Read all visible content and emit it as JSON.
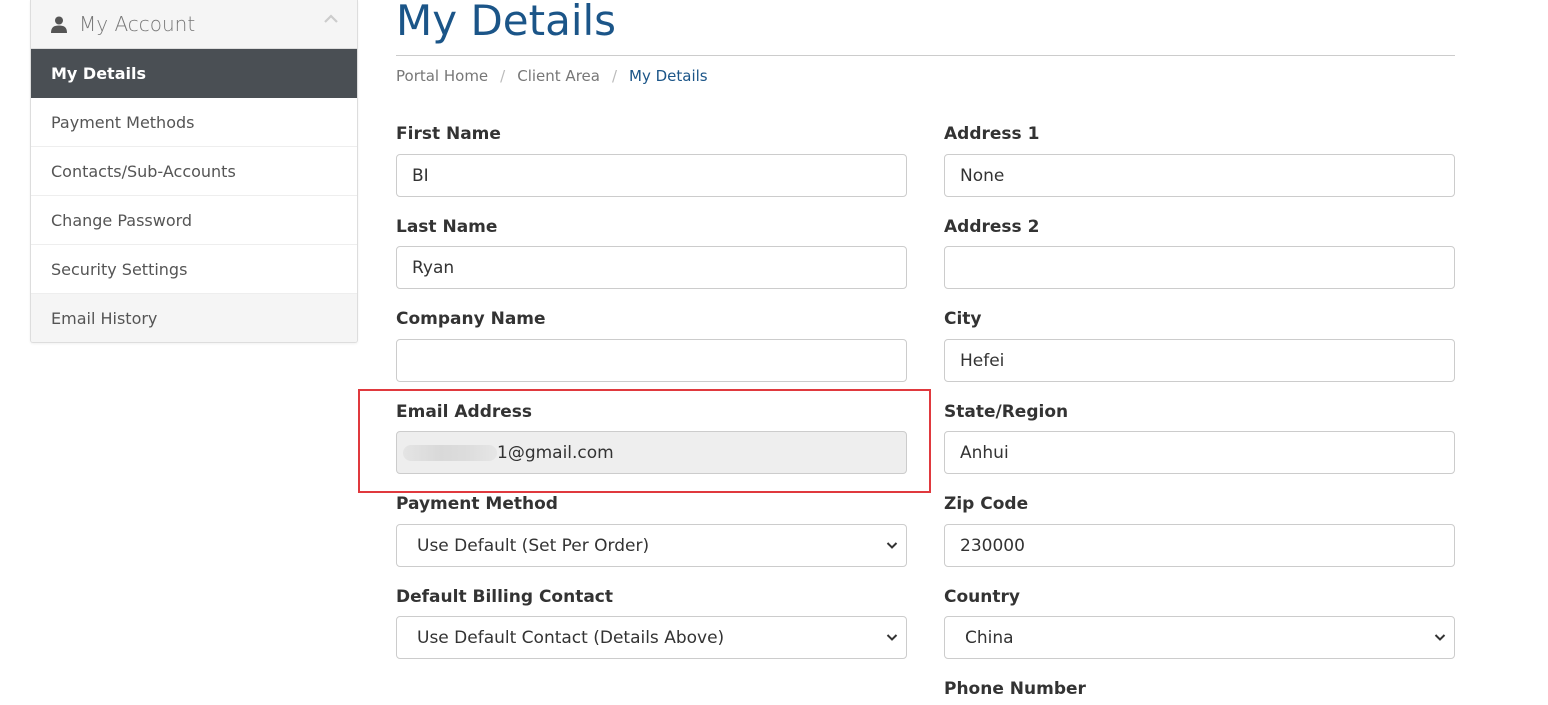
{
  "sidebar": {
    "header": {
      "title": "My Account",
      "icon": "user-icon",
      "toggle_icon": "chevron-up-icon"
    },
    "items": [
      {
        "label": "My Details",
        "active": true
      },
      {
        "label": "Payment Methods"
      },
      {
        "label": "Contacts/Sub-Accounts"
      },
      {
        "label": "Change Password"
      },
      {
        "label": "Security Settings"
      },
      {
        "label": "Email History"
      }
    ]
  },
  "page": {
    "title": "My Details",
    "breadcrumb": [
      "Portal Home",
      "Client Area",
      "My Details"
    ],
    "breadcrumb_separator": "/"
  },
  "form": {
    "first_name": {
      "label": "First Name",
      "value": "BI"
    },
    "last_name": {
      "label": "Last Name",
      "value": "Ryan"
    },
    "company_name": {
      "label": "Company Name",
      "value": ""
    },
    "email": {
      "label": "Email Address",
      "value_visible": "1@gmail.com",
      "redacted": true
    },
    "payment_method": {
      "label": "Payment Method",
      "selected": "Use Default (Set Per Order)"
    },
    "billing_contact": {
      "label": "Default Billing Contact",
      "selected": "Use Default Contact (Details Above)"
    },
    "address1": {
      "label": "Address 1",
      "value": "None"
    },
    "address2": {
      "label": "Address 2",
      "value": ""
    },
    "city": {
      "label": "City",
      "value": "Hefei"
    },
    "state": {
      "label": "State/Region",
      "value": "Anhui"
    },
    "zip": {
      "label": "Zip Code",
      "value": "230000"
    },
    "country": {
      "label": "Country",
      "selected": "China"
    },
    "phone": {
      "label": "Phone Number"
    }
  },
  "colors": {
    "accent": "#1b5588",
    "sidebar_active_bg": "#4a4f54",
    "highlight_border": "#e0393e"
  }
}
